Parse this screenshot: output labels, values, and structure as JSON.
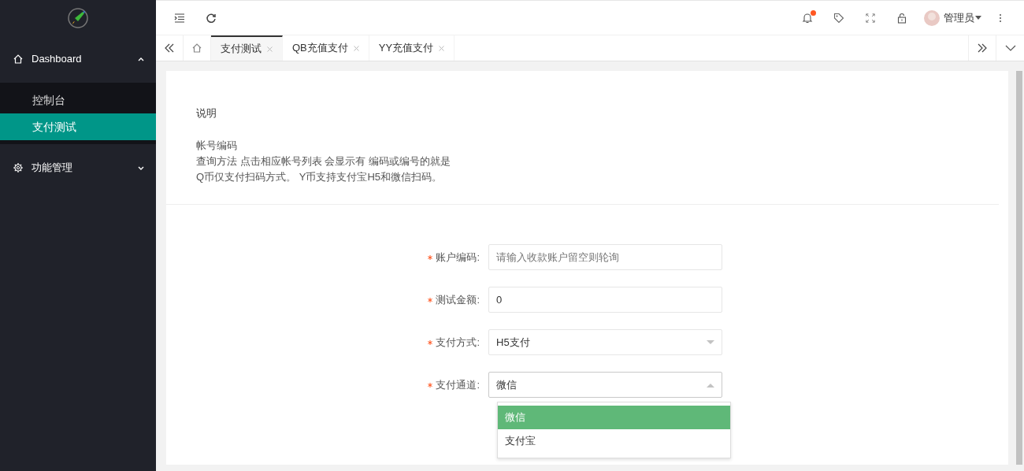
{
  "sidebar": {
    "items": [
      {
        "label": "Dashboard",
        "expanded": true,
        "children": [
          {
            "label": "控制台",
            "selected": false
          },
          {
            "label": "支付测试",
            "selected": true
          }
        ]
      },
      {
        "label": "功能管理",
        "expanded": false
      }
    ]
  },
  "header": {
    "user": "管理员",
    "notification_unread": true
  },
  "tabs": [
    {
      "label": "支付测试",
      "selected": true
    },
    {
      "label": "QB充值支付",
      "selected": false
    },
    {
      "label": "YY充值支付",
      "selected": false
    }
  ],
  "notice": {
    "title": "说明",
    "lines": [
      "帐号编码",
      "查询方法 点击相应帐号列表 会显示有 编码或编号的就是",
      "Q币仅支付扫码方式。 Y币支持支付宝H5和微信扫码。"
    ]
  },
  "form": {
    "fields": [
      {
        "kind": "text",
        "label": "账户编码:",
        "required": true,
        "placeholder": "请输入收款账户留空则轮询"
      },
      {
        "kind": "text",
        "label": "测试金额:",
        "required": true,
        "value": "0"
      },
      {
        "kind": "select",
        "label": "支付方式:",
        "required": true,
        "value": "H5支付",
        "expanded": false
      },
      {
        "kind": "select",
        "label": "支付通道:",
        "required": true,
        "value": "微信",
        "expanded": true,
        "options": [
          {
            "label": "微信",
            "selected": true
          },
          {
            "label": "支付宝",
            "selected": false
          }
        ]
      }
    ]
  }
}
